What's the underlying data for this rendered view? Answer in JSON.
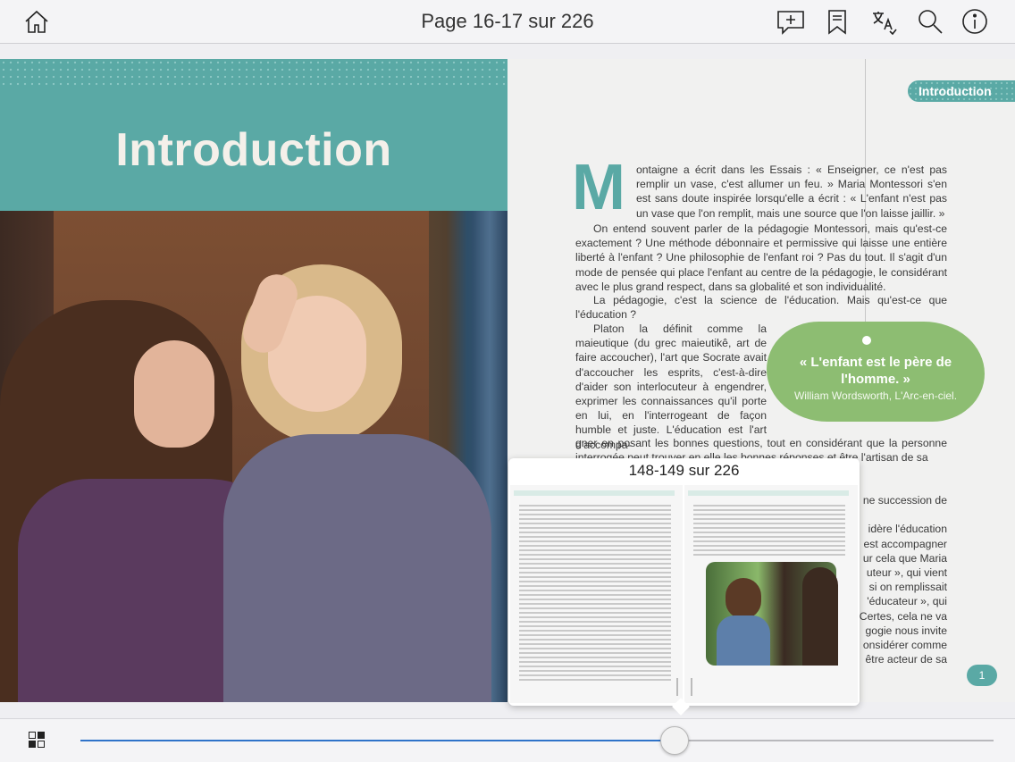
{
  "toolbar": {
    "title": "Page 16-17 sur 226",
    "icons": [
      "home-icon",
      "add-note-icon",
      "bookmark-icon",
      "translate-icon",
      "search-icon",
      "info-icon"
    ]
  },
  "left_page": {
    "title": "Introduction"
  },
  "right_page": {
    "tag": "Introduction",
    "dropcap": "M",
    "para1": "ontaigne a écrit dans les Essais : « Enseigner, ce n'est pas remplir un vase, c'est allumer un feu. » Maria Montessori s'en est sans doute inspirée lorsqu'elle a écrit : « L'enfant n'est pas un vase que l'on remplit, mais une source que l'on laisse jaillir. »",
    "para2": "On entend souvent parler de la pédagogie Montessori, mais qu'est-ce exactement ? Une méthode débonnaire et permissive qui laisse une entière liberté à l'enfant ? Une philosophie de l'enfant roi ? Pas du tout. Il s'agit d'un mode de pensée qui place l'enfant au centre de la pédagogie, le considérant avec le plus grand respect, dans sa globalité et son individualité.",
    "para3": "La pédagogie, c'est la science de l'éducation. Mais qu'est-ce que l'éducation ?",
    "para4": "Platon la définit comme la maieutique (du grec maieutikê, art de faire accoucher), l'art que Socrate avait d'accoucher les esprits, c'est-à-dire d'aider son interlocuteur à engendrer, exprimer les connaissances qu'il porte en lui, en l'interrogeant de façon humble et juste. L'éducation est l'art d'accompa-",
    "para5": "gner en posant les bonnes questions, tout en considérant que la personne interrogée peut trouver en elle les bonnes réponses et être l'artisan de sa",
    "para6": "ne succession de\n\nidère l'éducation\nest accompagner\nur cela que Maria\nuteur », qui vient\nsi on remplissait\n'éducateur », qui\nCertes, cela ne va\ngogie nous invite\nonsidérer comme\nêtre acteur de sa",
    "quote": "« L'enfant est le père de l'homme. »",
    "quote_source": "William Wordsworth, L'Arc-en-ciel.",
    "page_number": "1"
  },
  "preview": {
    "caption": "148-149 sur 226"
  },
  "slider": {
    "progress": 0.65
  },
  "colors": {
    "teal": "#5aa9a5",
    "green": "#8dbd72",
    "accent_blue": "#2f73c9"
  }
}
